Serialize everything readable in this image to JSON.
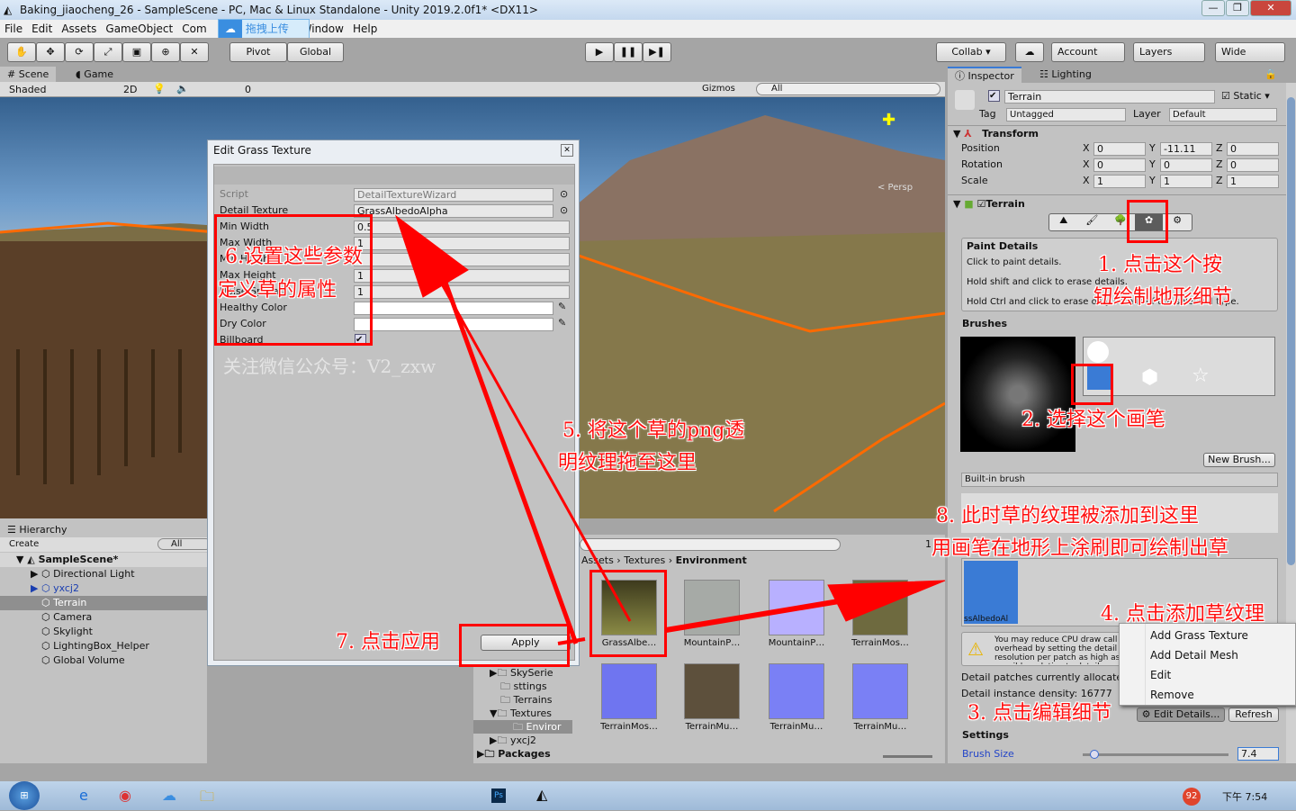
{
  "window": {
    "title": "Baking_jiaocheng_26 - SampleScene - PC, Mac & Linux Standalone - Unity 2019.2.0f1* <DX11>"
  },
  "menu": [
    "File",
    "Edit",
    "Assets",
    "GameObject",
    "Com",
    "Window",
    "Help"
  ],
  "upload_popup": "拖拽上传",
  "toolbar": {
    "pivot": "Pivot",
    "global": "Global",
    "collab": "Collab ▾",
    "account": "Account",
    "layers": "Layers",
    "layout": "Wide"
  },
  "scene": {
    "tab_scene": "Scene",
    "tab_game": "Game",
    "shading": "Shaded",
    "mode_2d": "2D",
    "hidden_count": "0",
    "gizmos": "Gizmos",
    "search": "All",
    "persp": "< Persp"
  },
  "dialog": {
    "title": "Edit Grass Texture",
    "fields": [
      {
        "label": "Script",
        "value": "DetailTextureWizard"
      },
      {
        "label": "Detail Texture",
        "value": "GrassAlbedoAlpha"
      },
      {
        "label": "Min Width",
        "value": "0.5"
      },
      {
        "label": "Max Width",
        "value": "1"
      },
      {
        "label": "Min Height",
        "value": ""
      },
      {
        "label": "Max Height",
        "value": "1"
      },
      {
        "label": "Noise Spread",
        "value": "1"
      },
      {
        "label": "Healthy Color",
        "value": ""
      },
      {
        "label": "Dry Color",
        "value": ""
      },
      {
        "label": "Billboard",
        "value": "checked"
      }
    ],
    "watermark": "关注微信公众号：V2_zxw",
    "apply": "Apply"
  },
  "hierarchy": {
    "tab": "Hierarchy",
    "create": "Create",
    "search": "All",
    "scene": "SampleScene*",
    "items": [
      "Directional Light",
      "yxcj2",
      "Terrain",
      "Camera",
      "Skylight",
      "LightingBox_Helper",
      "Global Volume"
    ]
  },
  "project": {
    "breadcrumb": [
      "Assets",
      "Textures",
      "Environment"
    ],
    "folders": [
      "SkySerie",
      "sttings",
      "Terrains",
      "Textures",
      "Enviror",
      "yxcj2",
      "Packages"
    ],
    "assets": [
      "GrassAlbe…",
      "MountainP…",
      "MountainP…",
      "TerrainMos…",
      "TerrainMos…",
      "TerrainMu…",
      "TerrainMu…",
      "TerrainMu…"
    ],
    "hidden_count": "1"
  },
  "inspector": {
    "tab": "Inspector",
    "tab_lighting": "Lighting",
    "name": "Terrain",
    "static": "Static",
    "tag_label": "Tag",
    "tag": "Untagged",
    "layer_label": "Layer",
    "layer": "Default",
    "transform": {
      "title": "Transform",
      "rows": [
        {
          "label": "Position",
          "x": "0",
          "y": "-11.11",
          "z": "0"
        },
        {
          "label": "Rotation",
          "x": "0",
          "y": "0",
          "z": "0"
        },
        {
          "label": "Scale",
          "x": "1",
          "y": "1",
          "z": "1"
        }
      ]
    },
    "terrain": {
      "title": "Terrain",
      "paint_title": "Paint Details",
      "help": [
        "Click to paint details.",
        "Hold shift and click to erase details.",
        "Hold Ctrl and click to erase only details of the selected type."
      ],
      "brushes": "Brushes",
      "new_brush": "New Brush...",
      "builtin": "Built-in brush",
      "detail_name": "ssAlbedoAl",
      "warning": "You may reduce CPU draw call overhead by setting the detail resolution per patch as high as possible, relative to detail resolution.",
      "patches": "Detail patches currently allocated",
      "density": "Detail instance density: 16777",
      "edit_details": "Edit Details...",
      "refresh": "Refresh",
      "settings": "Settings",
      "brush_size_label": "Brush Size",
      "brush_size": "7.4"
    }
  },
  "context_menu": [
    "Add Grass Texture",
    "Add Detail Mesh",
    "Edit",
    "Remove"
  ],
  "annotations": {
    "a1": "1. 点击这个按",
    "a1b": "钮绘制地形细节",
    "a2": "2. 选择这个画笔",
    "a3": "3. 点击编辑细节",
    "a4": "4. 点击添加草纹理",
    "a5": "5. 将这个草的png透",
    "a5b": "明纹理拖至这里",
    "a6": "6.设置这些参数",
    "a6b": "定义草的属性",
    "a7": "7. 点击应用",
    "a8": "8. 此时草的纹理被添加到这里",
    "a8b": "用画笔在地形上涂刷即可绘制出草"
  },
  "taskbar": {
    "clock": "下午 7:54",
    "badge": "92"
  },
  "colors": {
    "accent": "#3a7bd5",
    "annotation": "#ff0000"
  }
}
